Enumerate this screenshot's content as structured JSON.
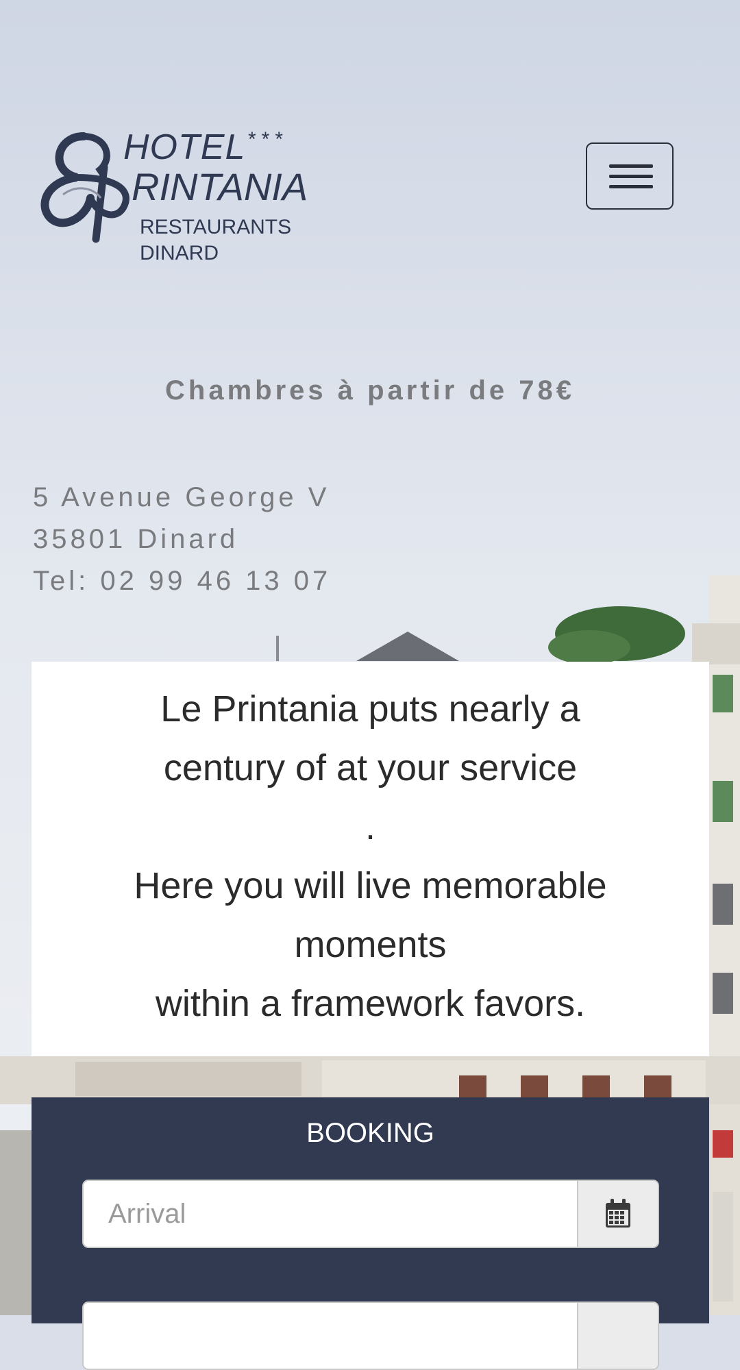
{
  "logo": {
    "hotel": "HOTEL",
    "stars": "***",
    "name": "RINTANIA",
    "sub1": "RESTAURANTS",
    "sub2": "DINARD"
  },
  "header": {
    "menu_icon": "hamburger-icon"
  },
  "tagline": "Chambres à partir de 78€",
  "address": {
    "street": "5 Avenue George V",
    "city": "35801 Dinard",
    "phone": "Tel: 02 99 46 13 07"
  },
  "intro": {
    "line1": "Le Printania puts nearly a",
    "line2": "century of at your service",
    "line3": ".",
    "line4": "Here you will live memorable",
    "line5": "moments",
    "line6": "within a framework favors."
  },
  "booking": {
    "title": "BOOKING",
    "arrival_placeholder": "Arrival",
    "calendar_icon": "calendar-icon"
  },
  "colors": {
    "brand_navy": "#323a52",
    "text_grey": "#7a7b7f"
  }
}
